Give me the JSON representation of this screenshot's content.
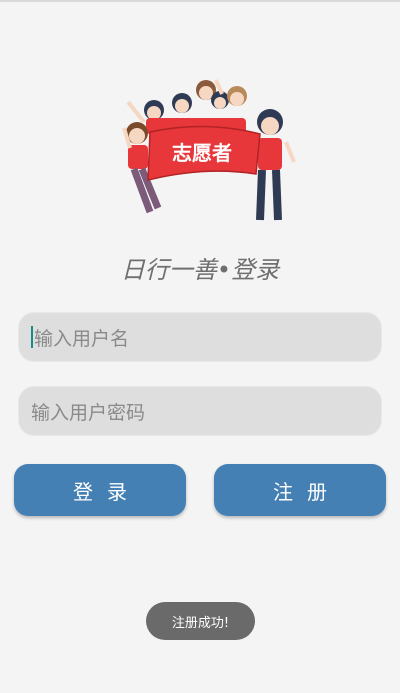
{
  "illustration": {
    "banner_text": "志愿者",
    "banner_color": "#e8373a",
    "shirt_color": "#e8373a"
  },
  "title": "日行一善•登录",
  "form": {
    "username_placeholder": "输入用户名",
    "password_placeholder": "输入用户密码"
  },
  "buttons": {
    "login_label": "登录",
    "register_label": "注册",
    "color": "#4580b5"
  },
  "toast": {
    "message": "注册成功!"
  }
}
